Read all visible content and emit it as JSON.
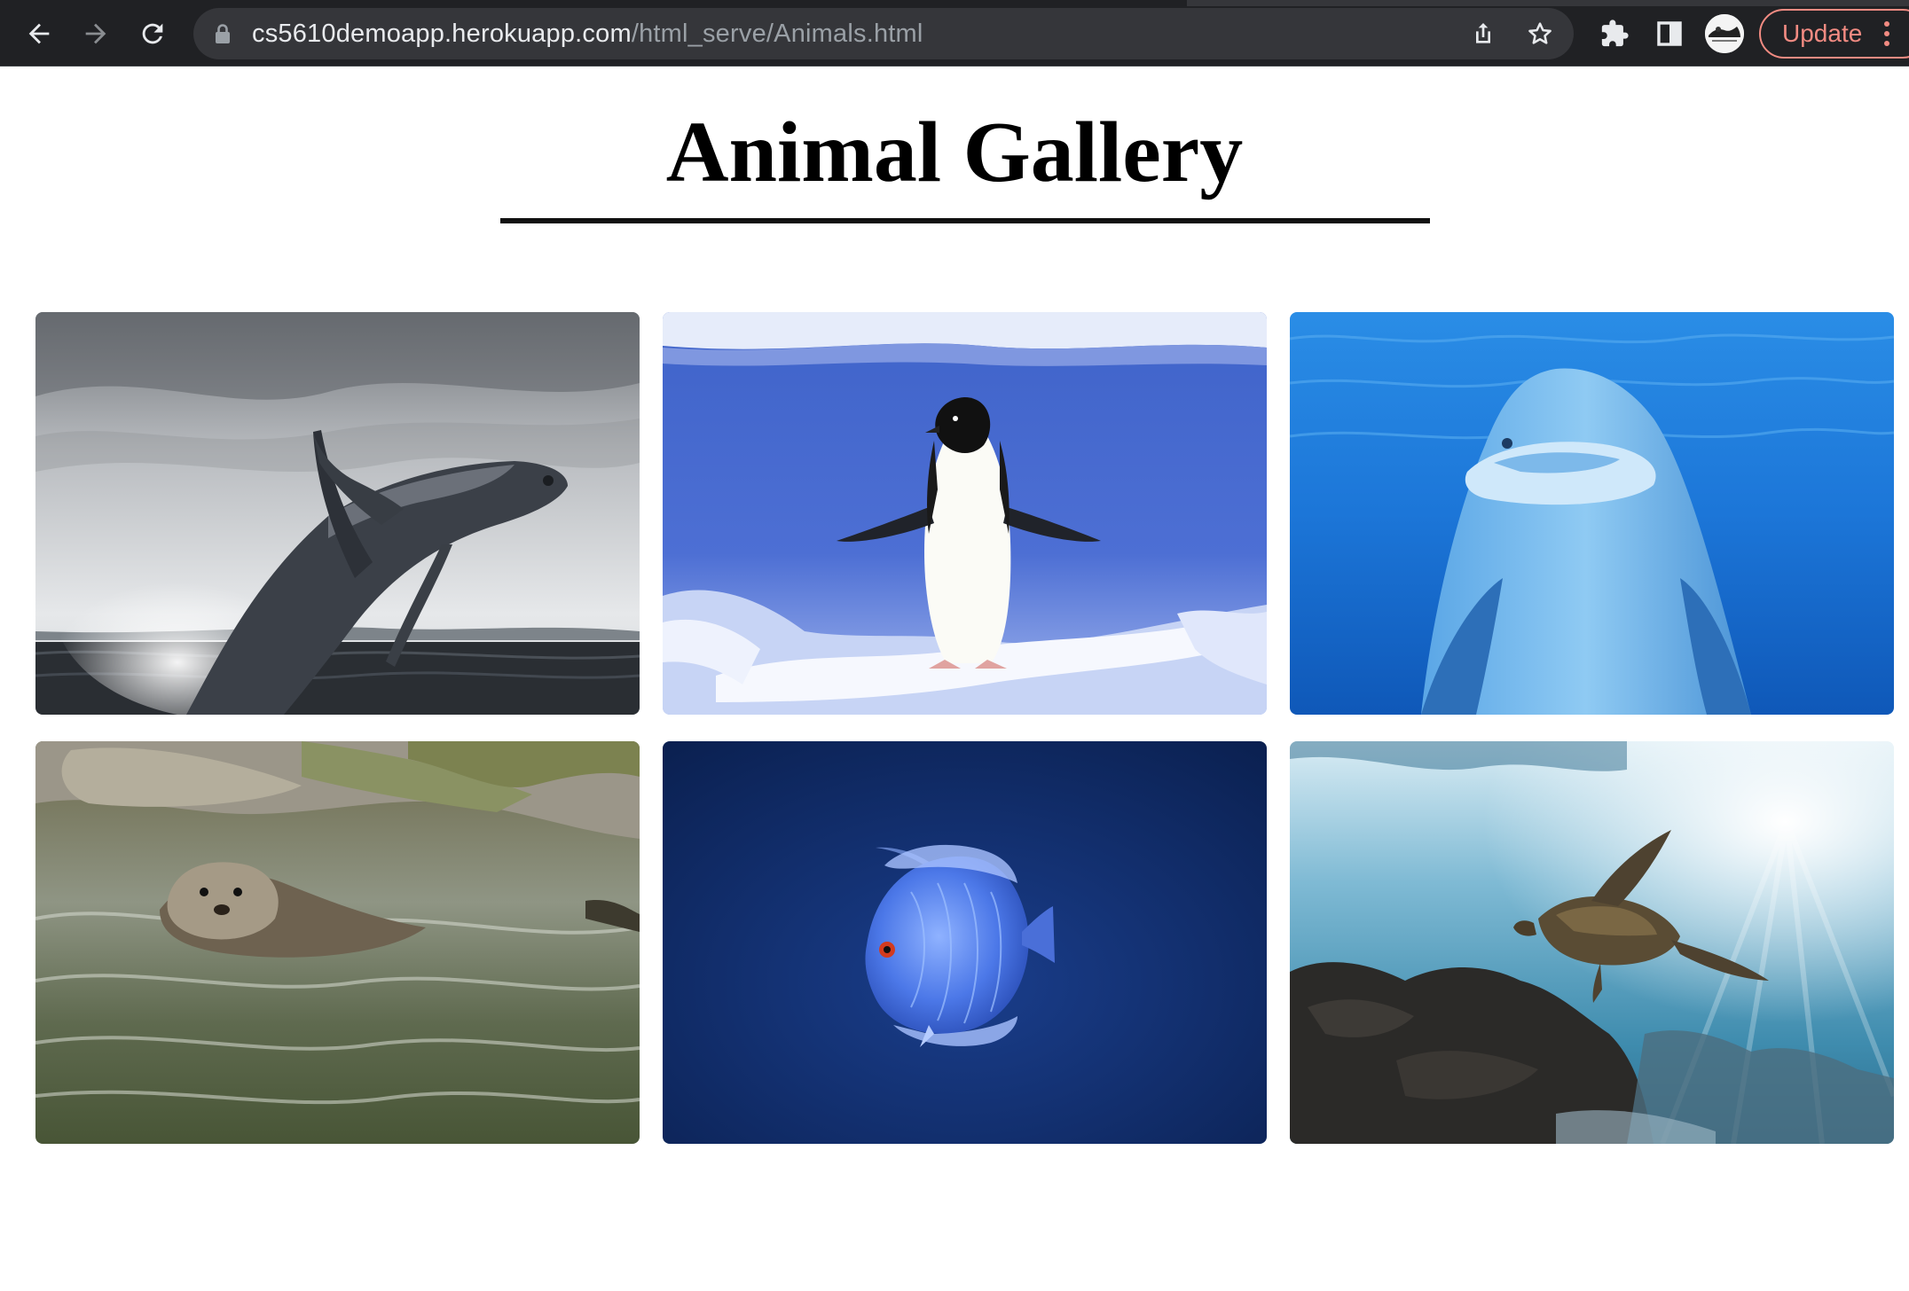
{
  "browser": {
    "url_host": "cs5610demoapp.herokuapp.com",
    "url_path": "/html_serve/Animals.html",
    "update_label": "Update",
    "icons": {
      "back": "arrow-left-icon",
      "forward": "arrow-right-icon",
      "reload": "reload-icon",
      "lock": "lock-icon",
      "share": "share-icon",
      "bookmark": "star-icon",
      "extensions": "puzzle-icon",
      "side_panel": "side-panel-icon",
      "menu": "kebab-menu-icon"
    },
    "colors": {
      "chrome_bg": "#202124",
      "omnibox_bg": "#35363a",
      "update_accent": "#f28b82"
    }
  },
  "page": {
    "title": "Animal Gallery",
    "images": [
      {
        "subject": "whale"
      },
      {
        "subject": "penguin"
      },
      {
        "subject": "dolphin"
      },
      {
        "subject": "otter"
      },
      {
        "subject": "fish"
      },
      {
        "subject": "sea turtle"
      }
    ]
  }
}
